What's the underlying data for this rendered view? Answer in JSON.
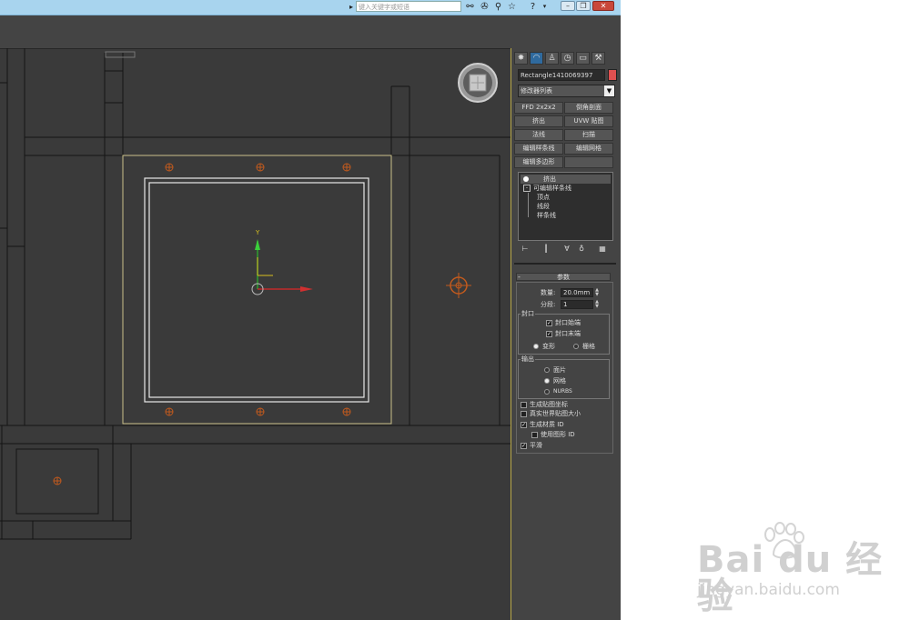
{
  "topbar": {
    "search_placeholder": "键入关键字或短语",
    "icons": [
      "binoculars-icon",
      "tools-icon",
      "connect-icon",
      "star-icon",
      "help-icon"
    ],
    "window_buttons": [
      "minimize",
      "restore",
      "close"
    ]
  },
  "panel": {
    "tabs": [
      "create",
      "modify",
      "hierarchy",
      "motion",
      "display",
      "utilities"
    ],
    "object_name": "Rectangle1410069397",
    "object_color": "#e05050",
    "modifier_list": "修改器列表",
    "modifier_buttons": [
      [
        "FFD 2x2x2",
        "倒角剖面"
      ],
      [
        "挤出",
        "UVW 贴图"
      ],
      [
        "法线",
        "扫描"
      ],
      [
        "编辑样条线",
        "编辑网格"
      ],
      [
        "编辑多边形",
        ""
      ]
    ],
    "stack": {
      "modifier": "挤出",
      "base": "可编辑样条线",
      "sub": [
        "顶点",
        "线段",
        "样条线"
      ]
    },
    "rollout_title": "参数",
    "params": {
      "amount_label": "数量:",
      "amount_value": "20.0mm",
      "segments_label": "分段:",
      "segments_value": "1"
    },
    "capping": {
      "title": "封口",
      "cap_start": "封口始端",
      "cap_end": "封口末端",
      "morph": "变形",
      "grid": "栅格"
    },
    "output": {
      "title": "输出",
      "patch": "面片",
      "mesh": "网格",
      "nurbs": "NURBS"
    },
    "options": {
      "gen_map": "生成贴图坐标",
      "real_world": "真实世界贴图大小",
      "gen_matid": "生成材质 ID",
      "use_shape": "使用图形 ID",
      "smooth": "平滑"
    }
  },
  "viewport": {
    "gizmo_axis_y": "Y"
  },
  "watermark": {
    "logo": "Bai du 经验",
    "url": "jingyan.baidu.com"
  }
}
